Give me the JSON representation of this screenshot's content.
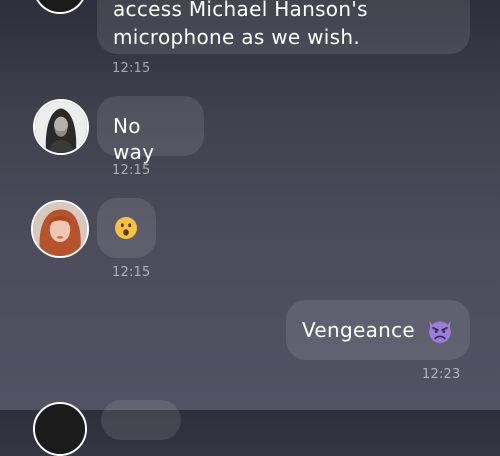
{
  "messages": [
    {
      "text_line1": "access Michael Hanson's",
      "text_line2": "microphone as we wish.",
      "time": "12:15"
    },
    {
      "text": "No way",
      "time": "12:15",
      "avatar": "avatar-hooded-man"
    },
    {
      "text": "😮",
      "time": "12:15",
      "avatar": "avatar-redhead-woman",
      "emoji_icon": "surprised-face-icon"
    },
    {
      "text": "Vengeance",
      "time": "12:23",
      "emoji_icon": "smiling-devil-icon"
    }
  ],
  "colors": {
    "bubble": "rgba(255,255,255,0.10)",
    "devil": "#9b7fd6",
    "emoji_yellow": "#f6c343"
  }
}
